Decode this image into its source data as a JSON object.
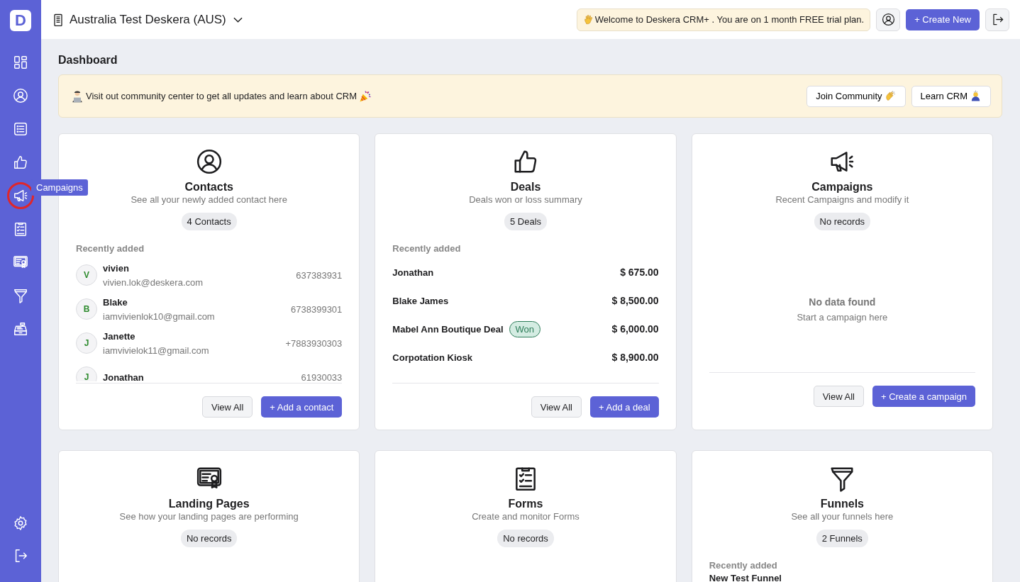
{
  "sidebar": {
    "logo": "D",
    "items": [
      {
        "kind": "dashboard",
        "highlighted": false
      },
      {
        "kind": "contacts",
        "highlighted": false
      },
      {
        "kind": "list",
        "highlighted": false
      },
      {
        "kind": "deals",
        "highlighted": false
      },
      {
        "kind": "campaigns",
        "highlighted": true
      },
      {
        "kind": "forms",
        "highlighted": false
      },
      {
        "kind": "landing",
        "highlighted": false
      },
      {
        "kind": "funnels",
        "highlighted": false
      },
      {
        "kind": "register",
        "highlighted": false
      }
    ],
    "bottom_items": [
      {
        "kind": "settings"
      },
      {
        "kind": "logout"
      }
    ],
    "tooltip": "Campaigns"
  },
  "header": {
    "organization": "Australia Test Deskera (AUS)",
    "welcome": "Welcome to Deskera CRM+ . You are on 1 month FREE trial plan.",
    "create_button": "+ Create New"
  },
  "page_title": "Dashboard",
  "banner": {
    "text": "Visit out community center to get all updates and learn about CRM",
    "buttons": [
      "Join Community",
      "Learn CRM"
    ]
  },
  "cards": [
    {
      "kind": "contacts",
      "title": "Contacts",
      "subtitle": "See all your newly added contact here",
      "count": "4 Contacts",
      "recent_label": "Recently added",
      "contacts": [
        {
          "initial": "V",
          "name": "vivien",
          "email": "vivien.lok@deskera.com",
          "phone": "637383931"
        },
        {
          "initial": "B",
          "name": "Blake",
          "email": "iamvivienlok10@gmail.com",
          "phone": "6738399301"
        },
        {
          "initial": "J",
          "name": "Janette",
          "email": "iamvivielok11@gmail.com",
          "phone": "+7883930303"
        },
        {
          "initial": "J",
          "name": "Jonathan",
          "phone": "61930033"
        }
      ],
      "buttons": [
        {
          "label": "View All",
          "primary": false
        },
        {
          "label": "+ Add a contact",
          "primary": true
        }
      ]
    },
    {
      "kind": "deals",
      "title": "Deals",
      "subtitle": "Deals won or loss summary",
      "count": "5 Deals",
      "recent_label": "Recently added",
      "deals": [
        {
          "name": "Jonathan",
          "amount": "$ 675.00"
        },
        {
          "name": "Blake James",
          "amount": "$ 8,500.00"
        },
        {
          "name": "Mabel Ann Boutique Deal",
          "status": "Won",
          "amount": "$ 6,000.00"
        },
        {
          "name": "Corpotation Kiosk",
          "amount": "$ 8,900.00"
        }
      ],
      "buttons": [
        {
          "label": "View All",
          "primary": false
        },
        {
          "label": "+ Add a deal",
          "primary": true
        }
      ]
    },
    {
      "kind": "campaigns",
      "title": "Campaigns",
      "subtitle": "Recent Campaigns and modify it",
      "count": "No records",
      "empty": {
        "title": "No data found",
        "hint": "Start a campaign here"
      },
      "buttons": [
        {
          "label": "View All",
          "primary": false
        },
        {
          "label": "+ Create a campaign",
          "primary": true
        }
      ]
    },
    {
      "kind": "landing",
      "title": "Landing Pages",
      "subtitle": "See how your landing pages are performing",
      "count": "No records"
    },
    {
      "kind": "forms",
      "title": "Forms",
      "subtitle": "Create and monitor Forms",
      "count": "No records"
    },
    {
      "kind": "funnels",
      "title": "Funnels",
      "subtitle": "See all your funnels here",
      "count": "2 Funnels",
      "recent_label": "Recently added",
      "funnels": [
        {
          "name": "New Test Funnel"
        }
      ]
    }
  ]
}
